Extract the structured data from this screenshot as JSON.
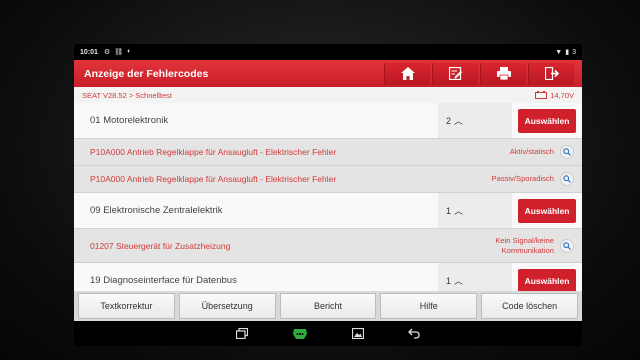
{
  "status": {
    "time": "10:01",
    "battery": "3"
  },
  "header": {
    "title": "Anzeige der Fehlercodes"
  },
  "toolbar": {
    "icons": [
      "home-icon",
      "edit-report-icon",
      "print-icon",
      "exit-icon"
    ]
  },
  "breadcrumb": {
    "path": "SEAT V28.52 > Schnelltest",
    "voltage": "14,70V"
  },
  "rows": [
    {
      "type": "ecu",
      "name": "01 Motorelektronik",
      "count": "2",
      "button": "Auswählen"
    },
    {
      "type": "dtc",
      "code": "P10A000 Antrieb Regelklappe für Ansaugluft - Elektrischer Fehler",
      "status": "Aktiv/statisch"
    },
    {
      "type": "dtc",
      "code": "P10A000 Antrieb Regelklappe für Ansaugluft - Elektrischer Fehler",
      "status": "Passiv/Sporadisch"
    },
    {
      "type": "ecu",
      "name": "09 Elektronische Zentralelektrik",
      "count": "1",
      "button": "Auswählen"
    },
    {
      "type": "dtc",
      "code": "01207 Steuergerät für Zusatzheizung",
      "status": "Kein Signal/keine Kommunikation"
    },
    {
      "type": "ecu",
      "name": "19 Diagnoseinterface für Datenbus",
      "count": "1",
      "button": "Auswählen"
    }
  ],
  "bottom": {
    "text_correction": "Textkorrektur",
    "translation": "Übersetzung",
    "report": "Bericht",
    "help": "Hilfe",
    "clear_codes": "Code löschen"
  },
  "colors": {
    "accent": "#d0202c",
    "dtc_text": "#d13a3a"
  }
}
